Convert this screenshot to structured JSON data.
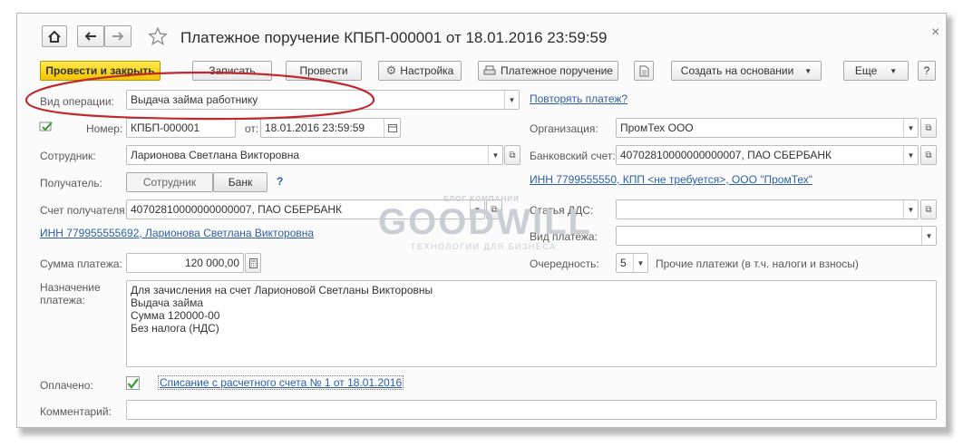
{
  "window": {
    "title": "Платежное поручение КПБП-000001 от 18.01.2016 23:59:59",
    "close_glyph": "×"
  },
  "toolbar": {
    "post_close": "Провести и закрыть",
    "save": "Записать",
    "post": "Провести",
    "settings": "Настройка",
    "print": "Платежное поручение",
    "create_based": "Создать на основании",
    "more": "Еще",
    "help": "?"
  },
  "form": {
    "operation_label": "Вид операции:",
    "operation_value": "Выдача займа работнику",
    "repeat_link": "Повторять платеж?",
    "number_label": "Номер:",
    "number_value": "КПБП-000001",
    "date_label": "от:",
    "date_value": "18.01.2016 23:59:59",
    "org_label": "Организация:",
    "org_value": "ПромТех ООО",
    "employee_label": "Сотрудник:",
    "employee_value": "Ларионова Светлана Викторовна",
    "bank_account_label": "Банковский счет:",
    "bank_account_value": "40702810000000000007, ПАО СБЕРБАНК",
    "recipient_label": "Получатель:",
    "recipient_toggle_employee": "Сотрудник",
    "recipient_toggle_bank": "Банк",
    "recipient_help": "?",
    "inn_org_link": "ИНН 7799555550, КПП <не требуется>, ООО \"ПромТех\"",
    "recipient_account_label": "Счет получателя:",
    "recipient_account_value": "40702810000000000007, ПАО СБЕРБАНК",
    "dds_label": "Статья ДДС:",
    "dds_value": "",
    "inn_recipient_link": "ИНН 779955555692, Ларионова Светлана Викторовна",
    "payment_type_label": "Вид платежа:",
    "payment_type_value": "",
    "amount_label": "Сумма платежа:",
    "amount_value": "120 000,00",
    "priority_label": "Очередность:",
    "priority_value": "5",
    "priority_desc": "Прочие платежи (в т.ч. налоги и взносы)",
    "purpose_label_1": "Назначение",
    "purpose_label_2": "платежа:",
    "purpose_lines": [
      "Для зачисления на счет Ларионовой Светланы Викторовны",
      "Выдача займа",
      "Сумма 120000-00",
      "Без налога (НДС)"
    ],
    "paid_label": "Оплачено:",
    "paid_checked": true,
    "writeoff_link": "Списание с расчетного счета № 1 от 18.01.2016",
    "comment_label": "Комментарий:",
    "comment_value": ""
  },
  "watermark": {
    "top": "БЛОГ КОМПАНИИ",
    "main": "GOODWILL",
    "sub": "ТЕХНОЛОГИИ ДЛЯ БИЗНЕСА"
  },
  "colors": {
    "primary_button": "#f4c400",
    "link": "#2c5fa8",
    "annotation_ellipse": "#c0282d"
  },
  "icons": [
    "home-icon",
    "back-arrow-icon",
    "forward-arrow-icon",
    "star-icon",
    "gear-icon",
    "printer-icon",
    "document-icon",
    "calendar-icon",
    "calculator-icon",
    "checkmark-icon",
    "open-icon",
    "chevron-down-icon"
  ]
}
